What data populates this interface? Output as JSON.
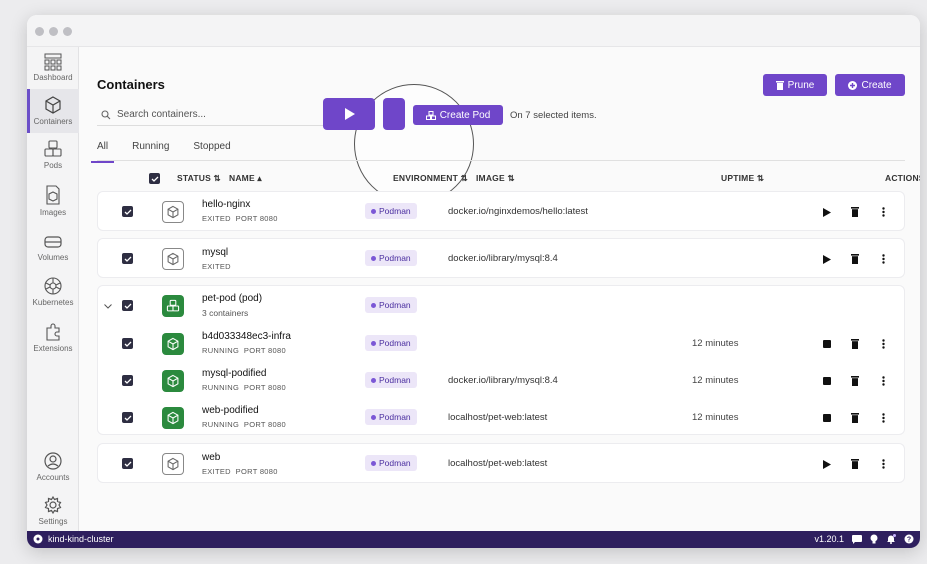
{
  "sidebar": {
    "items": [
      {
        "label": "Dashboard",
        "icon": "dashboard-icon"
      },
      {
        "label": "Containers",
        "icon": "container-icon",
        "active": true
      },
      {
        "label": "Pods",
        "icon": "pods-icon"
      },
      {
        "label": "Images",
        "icon": "images-icon"
      },
      {
        "label": "Volumes",
        "icon": "volumes-icon"
      },
      {
        "label": "Kubernetes",
        "icon": "kubernetes-icon"
      },
      {
        "label": "Extensions",
        "icon": "extensions-icon"
      }
    ],
    "bottom": [
      {
        "label": "Accounts",
        "icon": "account-icon"
      },
      {
        "label": "Settings",
        "icon": "settings-icon"
      }
    ]
  },
  "header": {
    "title": "Containers",
    "prune_label": "Prune",
    "create_label": "Create"
  },
  "search": {
    "placeholder": "Search containers..."
  },
  "bulk": {
    "create_pod_label": "Create Pod",
    "selected_text": "On 7 selected items."
  },
  "tabs": [
    "All",
    "Running",
    "Stopped"
  ],
  "columns": {
    "status": "STATUS",
    "name": "NAME",
    "environment": "ENVIRONMENT",
    "image": "IMAGE",
    "uptime": "UPTIME",
    "actions": "ACTIONS"
  },
  "rows": [
    {
      "name": "hello-nginx",
      "state": "EXITED",
      "port": "PORT 8080",
      "env": "Podman",
      "image": "docker.io/nginxdemos/hello:latest",
      "uptime": ""
    },
    {
      "name": "mysql",
      "state": "EXITED",
      "port": "",
      "env": "Podman",
      "image": "docker.io/library/mysql:8.4",
      "uptime": ""
    },
    {
      "name": "pet-pod (pod)",
      "state": "3 containers",
      "port": "",
      "env": "Podman",
      "image": "",
      "uptime": ""
    },
    {
      "name": "b4d033348ec3-infra",
      "state": "RUNNING",
      "port": "PORT 8080",
      "env": "Podman",
      "image": "",
      "uptime": "12 minutes"
    },
    {
      "name": "mysql-podified",
      "state": "RUNNING",
      "port": "PORT 8080",
      "env": "Podman",
      "image": "docker.io/library/mysql:8.4",
      "uptime": "12 minutes"
    },
    {
      "name": "web-podified",
      "state": "RUNNING",
      "port": "PORT 8080",
      "env": "Podman",
      "image": "localhost/pet-web:latest",
      "uptime": "12 minutes"
    },
    {
      "name": "web",
      "state": "EXITED",
      "port": "PORT 8080",
      "env": "Podman",
      "image": "localhost/pet-web:latest",
      "uptime": ""
    }
  ],
  "statusbar": {
    "context": "kind-kind-cluster",
    "version": "v1.20.1"
  },
  "colors": {
    "accent": "#6f46c9",
    "running": "#2b8a3e",
    "statusbar": "#2e1f5e"
  }
}
